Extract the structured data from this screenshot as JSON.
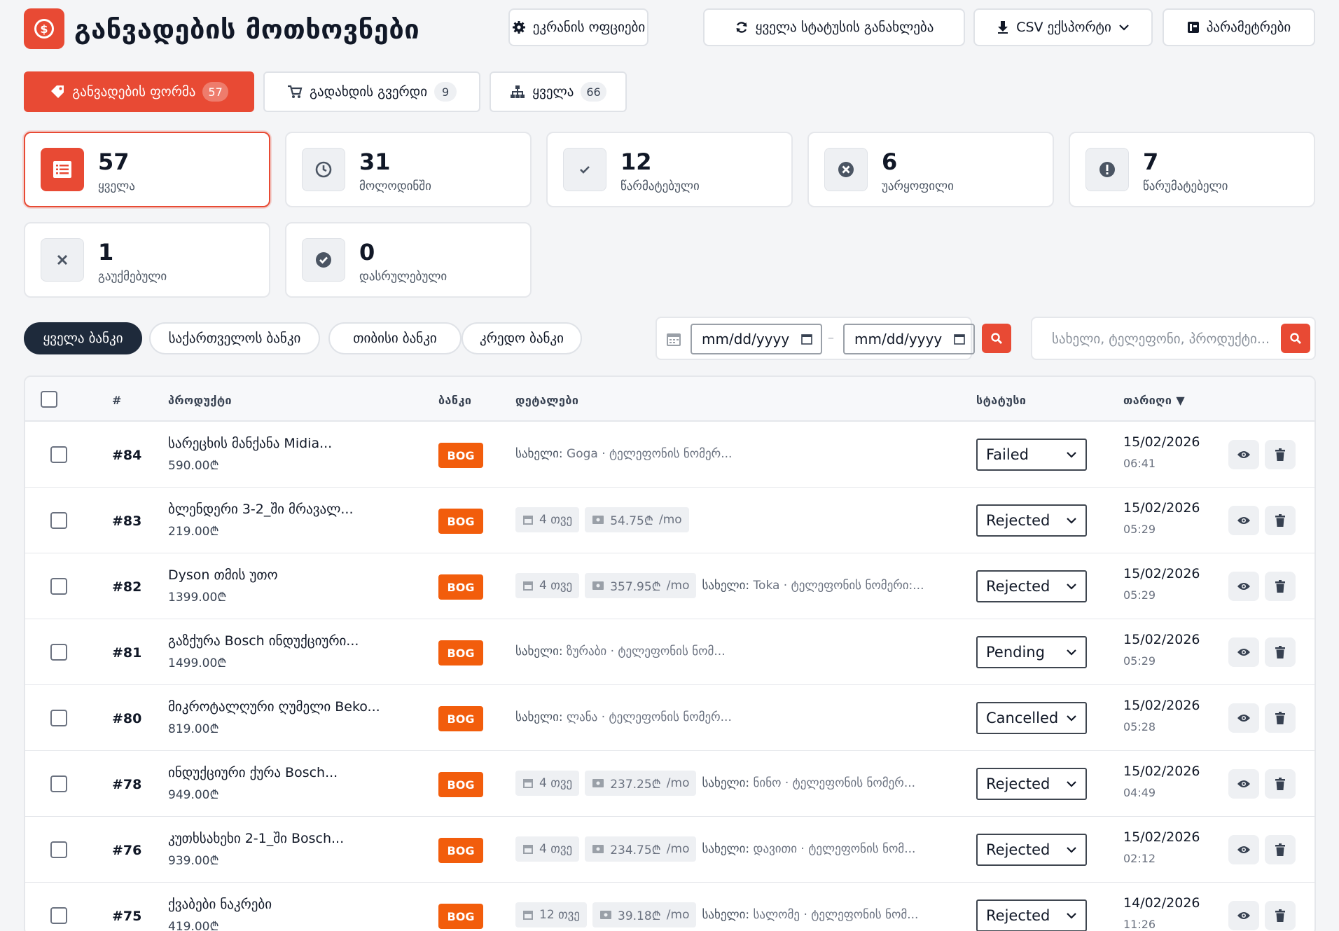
{
  "header": {
    "title": "განვადების მოთხოვნები",
    "logo_symbol": "$",
    "buttons": {
      "screen_office": "ეკრანის ოფციები",
      "refresh_statuses": "ყველა სტატუსის განახლება",
      "csv_export": "CSV ექსპორტი",
      "settings": "პარამეტრები"
    }
  },
  "form_tabs": [
    {
      "label": "განვადების ფორმა",
      "count": "57",
      "icon": "tag-icon"
    },
    {
      "label": "გადახდის გვერდი",
      "count": "9",
      "icon": "cart-icon"
    },
    {
      "label": "ყველა",
      "count": "66",
      "icon": "sitemap-icon"
    }
  ],
  "stats": [
    {
      "value": "57",
      "label": "ყველა",
      "icon": "list-icon"
    },
    {
      "value": "31",
      "label": "მოლოდინში",
      "icon": "clock-icon"
    },
    {
      "value": "12",
      "label": "წარმატებული",
      "icon": "check-icon"
    },
    {
      "value": "6",
      "label": "უარყოფილი",
      "icon": "x-circle-icon"
    },
    {
      "value": "7",
      "label": "წარუმატებელი",
      "icon": "exclamation-icon"
    },
    {
      "value": "1",
      "label": "გაუქმებული",
      "icon": "x-icon"
    },
    {
      "value": "0",
      "label": "დასრულებული",
      "icon": "check-circle-icon"
    }
  ],
  "bank_filters": [
    "ყველა ბანკი",
    "საქართველოს ბანკი",
    "თიბისი ბანკი",
    "კრედო ბანკი"
  ],
  "date_filter": {
    "from_placeholder": "mm/dd/yyyy",
    "to_placeholder": "mm/dd/yyyy",
    "separator": "–"
  },
  "search": {
    "placeholder": "სახელი, ტელეფონი, პროდუქტი..."
  },
  "table": {
    "headers": {
      "id": "#",
      "product": "პროდუქტი",
      "bank": "ბანკი",
      "details": "დეტალები",
      "status": "სტატუსი",
      "date": "თარიღი ▼"
    },
    "rows": [
      {
        "id": "#84",
        "product": "სარეცხის მანქანა Midia...",
        "price": "590.00₾",
        "bank": "BOG",
        "months": "",
        "monthly": "",
        "monthly_unit": "",
        "name_label": "სახელი:",
        "name_value": " Goga · ტელეფონის ნომერ...",
        "status": "Failed",
        "date": "15/02/2026",
        "time": "06:41"
      },
      {
        "id": "#83",
        "product": "ბლენდერი 3-2_ში მრავალ...",
        "price": "219.00₾",
        "bank": "BOG",
        "months": "4 თვე",
        "monthly": "54.75₾",
        "monthly_unit": "/mo",
        "name_label": "",
        "name_value": "",
        "status": "Rejected",
        "date": "15/02/2026",
        "time": "05:29"
      },
      {
        "id": "#82",
        "product": "Dyson თმის უთო",
        "price": "1399.00₾",
        "bank": "BOG",
        "months": "4 თვე",
        "monthly": "357.95₾",
        "monthly_unit": "/mo",
        "name_label": "სახელი:",
        "name_value": " Toka · ტელეფონის ნომერი:...",
        "status": "Rejected",
        "date": "15/02/2026",
        "time": "05:29"
      },
      {
        "id": "#81",
        "product": "გაზქურა Bosch ინდუქციური...",
        "price": "1499.00₾",
        "bank": "BOG",
        "months": "",
        "monthly": "",
        "monthly_unit": "",
        "name_label": "სახელი:",
        "name_value": " ზურაბი · ტელეფონის ნომ...",
        "status": "Pending",
        "date": "15/02/2026",
        "time": "05:29"
      },
      {
        "id": "#80",
        "product": "მიკროტალღური ღუმელი Beko...",
        "price": "819.00₾",
        "bank": "BOG",
        "months": "",
        "monthly": "",
        "monthly_unit": "",
        "name_label": "სახელი:",
        "name_value": " ლანა · ტელეფონის ნომერ...",
        "status": "Cancelled",
        "date": "15/02/2026",
        "time": "05:28"
      },
      {
        "id": "#78",
        "product": "ინდუქციური ქურა Bosch...",
        "price": "949.00₾",
        "bank": "BOG",
        "months": "4 თვე",
        "monthly": "237.25₾",
        "monthly_unit": "/mo",
        "name_label": "სახელი:",
        "name_value": " ნინო · ტელეფონის ნომერ...",
        "status": "Rejected",
        "date": "15/02/2026",
        "time": "04:49"
      },
      {
        "id": "#76",
        "product": "კუთხსახეხი 2-1_ში Bosch...",
        "price": "939.00₾",
        "bank": "BOG",
        "months": "4 თვე",
        "monthly": "234.75₾",
        "monthly_unit": "/mo",
        "name_label": "სახელი:",
        "name_value": " დავითი · ტელეფონის ნომ...",
        "status": "Rejected",
        "date": "15/02/2026",
        "time": "02:12"
      },
      {
        "id": "#75",
        "product": "ქვაბები ნაკრები",
        "price": "419.00₾",
        "bank": "BOG",
        "months": "12 თვე",
        "monthly": "39.18₾",
        "monthly_unit": "/mo",
        "name_label": "სახელი:",
        "name_value": " სალომე · ტელეფონის ნომ...",
        "status": "Rejected",
        "date": "14/02/2026",
        "time": "11:26"
      }
    ]
  },
  "colors": {
    "accent": "#e84a34",
    "bank_badge": "#f25d0c",
    "dark_pill": "#1e2a3b"
  }
}
